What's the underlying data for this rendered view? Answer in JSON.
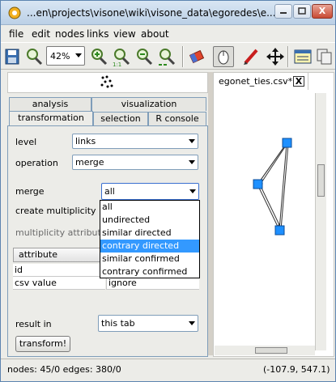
{
  "window": {
    "title": "...en\\projects\\visone\\wiki\\visone_data\\egoredes\\e...",
    "controls": {
      "minimize": "–",
      "maximize": "□",
      "close": "X"
    }
  },
  "menu": [
    "file",
    "edit",
    "nodes",
    "links",
    "view",
    "about"
  ],
  "toolbar": {
    "zoom_value": "42%",
    "icons": [
      "save-icon",
      "zoom-icon",
      "zoom-in-icon",
      "zoom-fit-icon",
      "zoom-out-icon",
      "zoom-selection-icon",
      "zoom-all-icon",
      "eraser-icon",
      "mouse-icon",
      "pencil-icon",
      "move-icon",
      "panel-icon",
      "copy-icon"
    ]
  },
  "left_panel": {
    "tabs_row1": [
      "analysis",
      "visualization"
    ],
    "tabs_row2": [
      "transformation",
      "selection",
      "R console"
    ],
    "active_tab": "transformation",
    "level_label": "level",
    "level_value": "links",
    "operation_label": "operation",
    "operation_value": "merge",
    "merge_label": "merge",
    "merge_value": "all",
    "create_multiplicity_label": "create multiplicity",
    "multiplicity_attribute_label": "multiplicity attribute",
    "merge_options": [
      "all",
      "undirected",
      "similar directed",
      "contrary directed",
      "similar confirmed",
      "contrary confirmed"
    ],
    "merge_selected_index": 3,
    "table": {
      "header": "attribute",
      "rows": [
        {
          "attribute": "id",
          "value": ""
        },
        {
          "attribute": "csv value",
          "value": "ignore"
        }
      ]
    },
    "result_label": "result in",
    "result_value": "this tab",
    "transform_button": "transform!"
  },
  "right_panel": {
    "tab_label": "egonet_ties.csv*",
    "tab_close": "X"
  },
  "status": {
    "left": "nodes: 45/0  edges: 380/0",
    "right": "(-107.9, 547.1)"
  },
  "colors": {
    "node": "#1e90ff",
    "selection": "#3399ff",
    "panel": "#ecece8"
  }
}
